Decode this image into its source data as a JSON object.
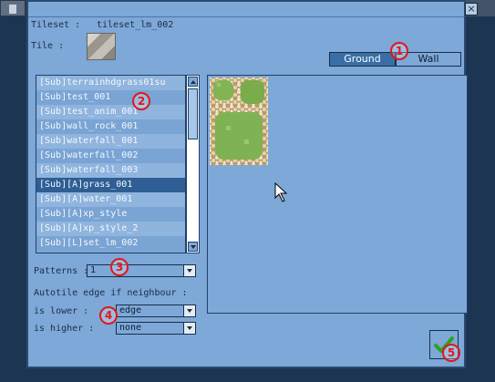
{
  "toolbar": {
    "buttons": [
      {
        "icon": "file-icon"
      },
      {
        "icon": "layer-icon"
      },
      {
        "icon": "paint-icon"
      },
      {
        "icon": "tileset-icon"
      }
    ]
  },
  "dialog": {
    "close_label": "×",
    "tileset_label": "Tileset : ",
    "tileset_value": "tileset_lm_002",
    "tile_label": "Tile :",
    "tabs": [
      {
        "label": "Ground",
        "active": true
      },
      {
        "label": "Wall",
        "active": false
      }
    ],
    "autotiles": [
      "[Sub]terrainhdgrass01su",
      "[Sub]test_001",
      "[Sub]test_anim_001",
      "[Sub]wall_rock_001",
      "[Sub]waterfall_001",
      "[Sub]waterfall_002",
      "[Sub]waterfall_003",
      "[Sub][A]grass_001",
      "[Sub][A]water_001",
      "[Sub][A]xp_style",
      "[Sub][A]xp_style_2",
      "[Sub][L]set_lm_002"
    ],
    "selected_index": 7,
    "patterns_label": "Patterns :",
    "patterns_value": "1",
    "autotile_edge_label": "Autotile edge if neighbour :",
    "is_lower_label": "is lower :",
    "is_lower_value": "edge",
    "is_higher_label": "is higher :",
    "is_higher_value": "none"
  },
  "markers": [
    "1",
    "2",
    "3",
    "4",
    "5"
  ],
  "colors": {
    "accent": "#3a6ea4",
    "panel": "#7da8d8",
    "marker": "#e01818"
  }
}
